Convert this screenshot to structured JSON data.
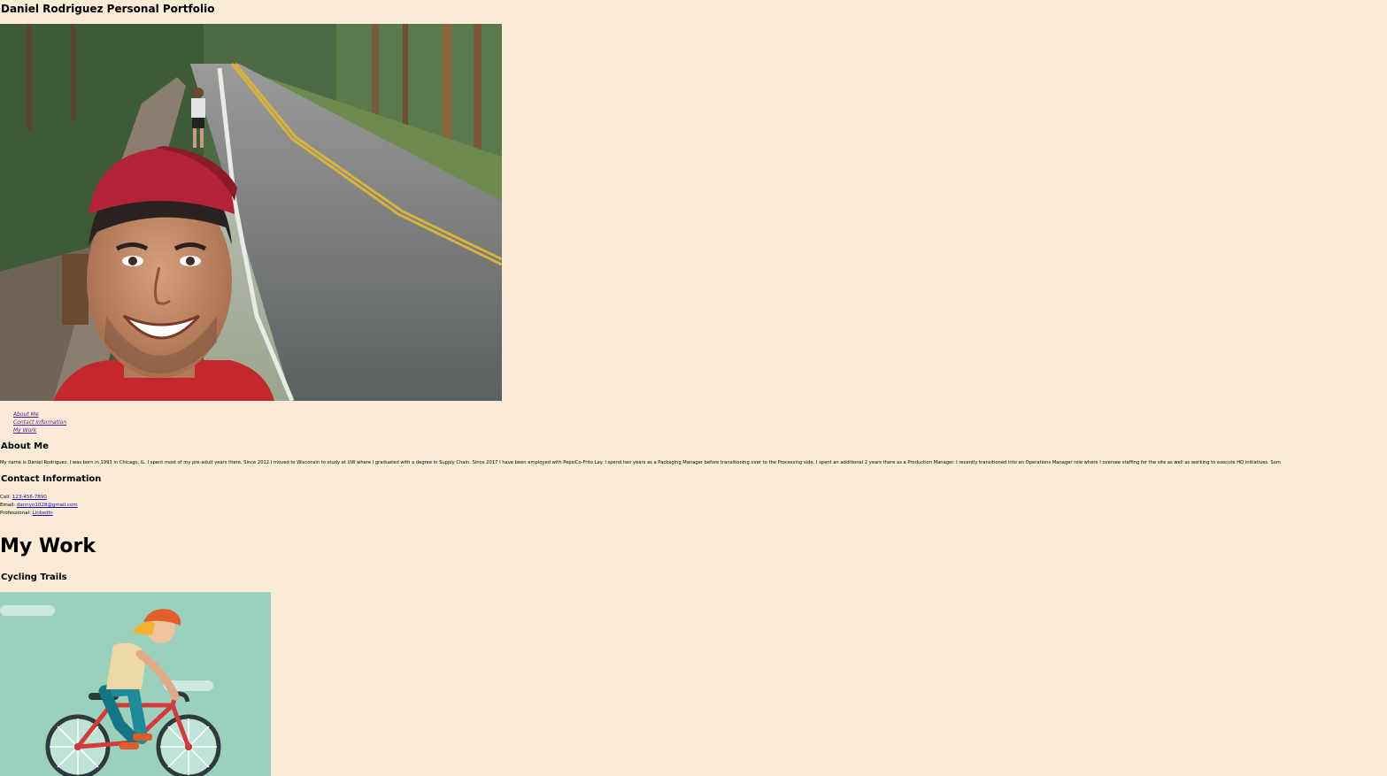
{
  "header": {
    "title": "Daniel Rodriguez Personal Portfolio"
  },
  "nav": {
    "items": [
      {
        "label": "About Me"
      },
      {
        "label": "Contact Information"
      },
      {
        "label": "My Work"
      }
    ]
  },
  "about": {
    "heading": "About Me",
    "text": "My name is Daniel Rodriguez. I was born in 1993 in Chicago, IL. I spent most of my pre-adult years there. Since 2012 I moved to Wisconsin to study at UW where I graduated with a degree in Supply Chain. Since 2017 I have been employed with PepsiCo-Frito Lay. I spend two years as a Packaging Manager before transitioning over to the Processing side. I spent an additional 2 years there as a Production Manager. I recently transitioned into an Operations Manager role where I oversee staffing for the site as well as working to execute HQ initiatives. Som"
  },
  "contact": {
    "heading": "Contact Information",
    "cell_label": "Cell:",
    "cell_value": "123-456-7890",
    "email_label": "Email:",
    "email_value": "dannyo1028@gmail.com",
    "professional_label": "Professional:",
    "professional_value": "LinkedIn"
  },
  "work": {
    "heading": "My Work",
    "project_title": "Cycling Trails"
  },
  "colors": {
    "background": "#faebd7",
    "link": "#1a0dab",
    "visited_link": "#551a8b",
    "project_bg": "#9bd1bc"
  }
}
